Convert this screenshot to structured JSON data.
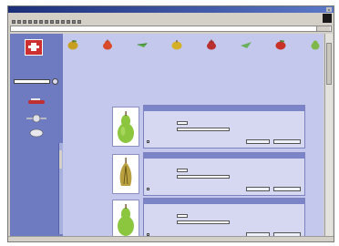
{
  "window": {
    "title": "",
    "close_label": "x"
  },
  "menu": {
    "items": [
      "",
      "",
      "",
      "",
      "",
      ""
    ]
  },
  "brand_badge": "",
  "address": {
    "url": "",
    "go_label": ""
  },
  "sidebar": {
    "title": "",
    "search_label": "",
    "links": [
      "",
      "",
      "",
      "",
      "",
      ""
    ],
    "heading": ""
  },
  "nav": {
    "links": [
      "",
      "",
      "",
      ""
    ]
  },
  "intro_text": "",
  "colors": {
    "sidebar": "#6f7bc0",
    "page": "#c4c8ec",
    "panel_head": "#7c84c8",
    "pear": "#8cc63f"
  },
  "fruits": [
    "apple-icon",
    "pear-icon",
    "grapes-icon",
    "apple-icon",
    "pear-icon",
    "apple-icon"
  ],
  "products": [
    {
      "name": "",
      "price": "",
      "qty_label": "",
      "size_label": "",
      "check_label": "",
      "btn_a": "",
      "btn_b": ""
    },
    {
      "name": "",
      "price": "",
      "qty_label": "",
      "size_label": "",
      "check_label": "",
      "btn_a": "",
      "btn_b": ""
    },
    {
      "name": "",
      "price": "",
      "qty_label": "",
      "size_label": "",
      "check_label": "",
      "btn_a": "",
      "btn_b": ""
    }
  ],
  "status": ""
}
